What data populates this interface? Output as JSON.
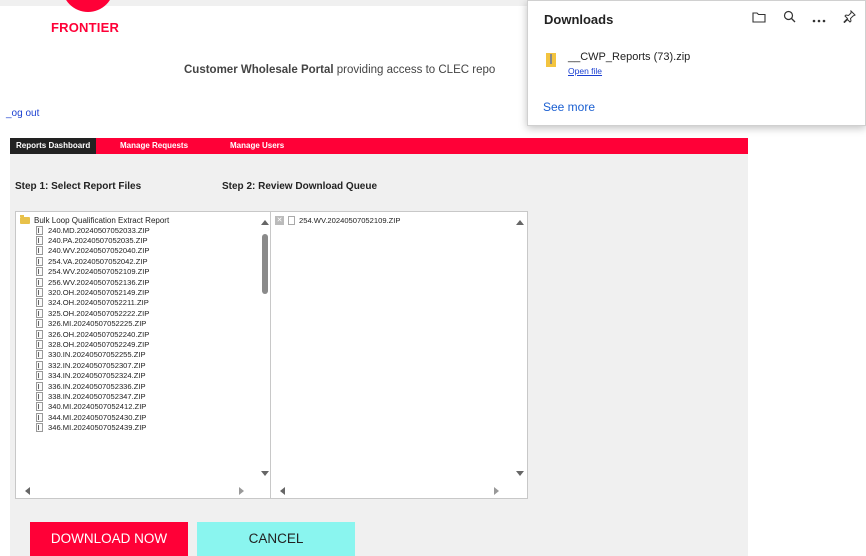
{
  "brand": {
    "name": "FRONTIER",
    "color": "#ff0037"
  },
  "header": {
    "subtitle_bold": "Customer Wholesale Portal",
    "subtitle_rest": " providing access to CLEC repo"
  },
  "logout": "_og out",
  "nav": {
    "items": [
      {
        "label": "Reports Dashboard",
        "active": true
      },
      {
        "label": "Manage Requests",
        "active": false
      },
      {
        "label": "Manage Users",
        "active": false
      }
    ]
  },
  "steps": {
    "step1": "Step 1: Select Report Files",
    "step2": "Step 2: Review Download Queue"
  },
  "report_tree": {
    "folder": "Bulk Loop Qualification Extract Report",
    "files": [
      "240.MD.20240507052033.ZIP",
      "240.PA.20240507052035.ZIP",
      "240.WV.20240507052040.ZIP",
      "254.VA.20240507052042.ZIP",
      "254.WV.20240507052109.ZIP",
      "256.WV.20240507052136.ZIP",
      "320.OH.20240507052149.ZIP",
      "324.OH.20240507052211.ZIP",
      "325.OH.20240507052222.ZIP",
      "326.MI.20240507052225.ZIP",
      "326.OH.20240507052240.ZIP",
      "328.OH.20240507052249.ZIP",
      "330.IN.20240507052255.ZIP",
      "332.IN.20240507052307.ZIP",
      "334.IN.20240507052324.ZIP",
      "336.IN.20240507052336.ZIP",
      "338.IN.20240507052347.ZIP",
      "340.MI.20240507052412.ZIP",
      "344.MI.20240507052430.ZIP",
      "346.MI.20240507052439.ZIP"
    ]
  },
  "queue": {
    "items": [
      "254.WV.20240507052109.ZIP"
    ]
  },
  "buttons": {
    "download": "DOWNLOAD NOW",
    "cancel": "CANCEL"
  },
  "downloads_flyout": {
    "title": "Downloads",
    "icons": [
      "folder-icon",
      "search-icon",
      "more-icon",
      "pin-icon"
    ],
    "file": {
      "name": "__CWP_Reports (73).zip",
      "action": "Open file"
    },
    "see_more": "See more"
  }
}
